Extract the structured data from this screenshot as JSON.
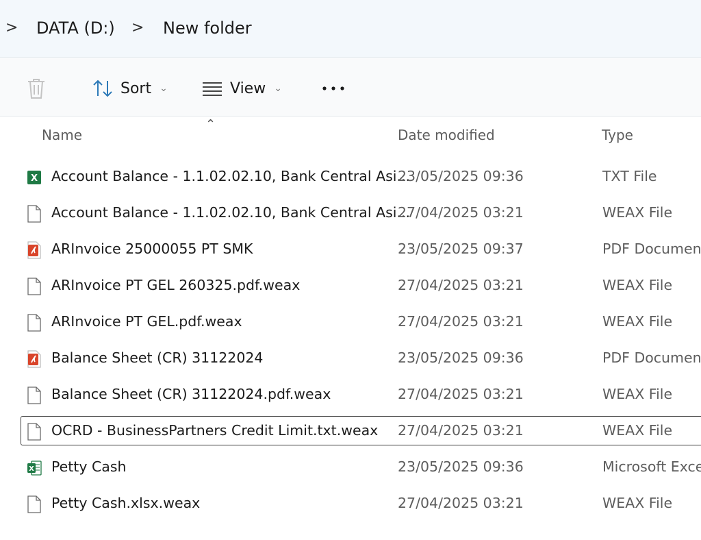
{
  "breadcrumb": {
    "separator": ">",
    "items": [
      "DATA (D:)",
      "New folder"
    ]
  },
  "commandbar": {
    "delete_icon": "trash-icon",
    "sort_label": "Sort",
    "view_label": "View",
    "more_label": "•••"
  },
  "columns": {
    "name": "Name",
    "date": "Date modified",
    "type": "Type",
    "sort_indicator": "^"
  },
  "files": [
    {
      "icon": "excel-icon",
      "name": "Account Balance - 1.1.02.02.10, Bank Central Asi...",
      "date": "23/05/2025 09:36",
      "type": "TXT File"
    },
    {
      "icon": "file-icon",
      "name": "Account Balance - 1.1.02.02.10, Bank Central Asi...",
      "date": "27/04/2025 03:21",
      "type": "WEAX File"
    },
    {
      "icon": "pdf-icon",
      "name": "ARInvoice 25000055 PT SMK",
      "date": "23/05/2025 09:37",
      "type": "PDF Document"
    },
    {
      "icon": "file-icon",
      "name": "ARInvoice PT GEL 260325.pdf.weax",
      "date": "27/04/2025 03:21",
      "type": "WEAX File"
    },
    {
      "icon": "file-icon",
      "name": "ARInvoice PT GEL.pdf.weax",
      "date": "27/04/2025 03:21",
      "type": "WEAX File"
    },
    {
      "icon": "pdf-icon",
      "name": "Balance Sheet (CR) 31122024",
      "date": "23/05/2025 09:36",
      "type": "PDF Document"
    },
    {
      "icon": "file-icon",
      "name": "Balance Sheet (CR) 31122024.pdf.weax",
      "date": "27/04/2025 03:21",
      "type": "WEAX File"
    },
    {
      "icon": "file-icon",
      "name": "OCRD - BusinessPartners Credit Limit.txt.weax",
      "date": "27/04/2025 03:21",
      "type": "WEAX File",
      "focused": true
    },
    {
      "icon": "excel-sheet-icon",
      "name": "Petty Cash",
      "date": "23/05/2025 09:36",
      "type": "Microsoft Excel"
    },
    {
      "icon": "file-icon",
      "name": "Petty Cash.xlsx.weax",
      "date": "27/04/2025 03:21",
      "type": "WEAX File"
    }
  ],
  "colors": {
    "address_bg": "#f3f8fc",
    "excel_green": "#1f7a45",
    "pdf_red": "#d9442a",
    "focus_border": "#3b3b3b"
  }
}
